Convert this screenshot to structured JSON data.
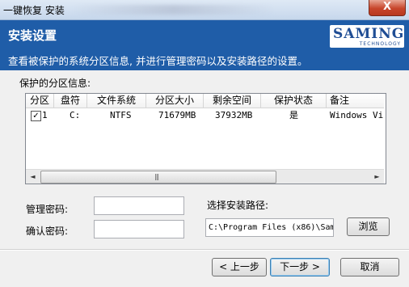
{
  "window": {
    "title": "一键恢复 安装",
    "close_glyph": "X"
  },
  "header": {
    "title": "安装设置",
    "description": "查看被保护的系统分区信息, 并进行管理密码以及安装路径的设置。",
    "logo_main": "SAMING",
    "logo_sub": "TECHNOLOGY"
  },
  "partition_section": {
    "label": "保护的分区信息:",
    "columns": [
      "分区",
      "盘符",
      "文件系统",
      "分区大小",
      "剩余空间",
      "保护状态",
      "备注"
    ],
    "rows": [
      {
        "checked": true,
        "partition": "1",
        "drive": "C:",
        "filesystem": "NTFS",
        "size": "71679MB",
        "free": "37932MB",
        "status": "是",
        "note": "Windows Vis"
      }
    ],
    "scroll_left": "◄",
    "scroll_right": "►",
    "scroll_grip": "|||"
  },
  "form": {
    "admin_password_label": "管理密码:",
    "admin_password_value": "",
    "confirm_password_label": "确认密码:",
    "confirm_password_value": "",
    "install_path_label": "选择安装路径:",
    "install_path_value": "C:\\Program Files (x86)\\Sam",
    "browse_label": "浏览"
  },
  "footer": {
    "back_label": "< 上一步",
    "next_label": "下一步 >",
    "cancel_label": "取消"
  }
}
